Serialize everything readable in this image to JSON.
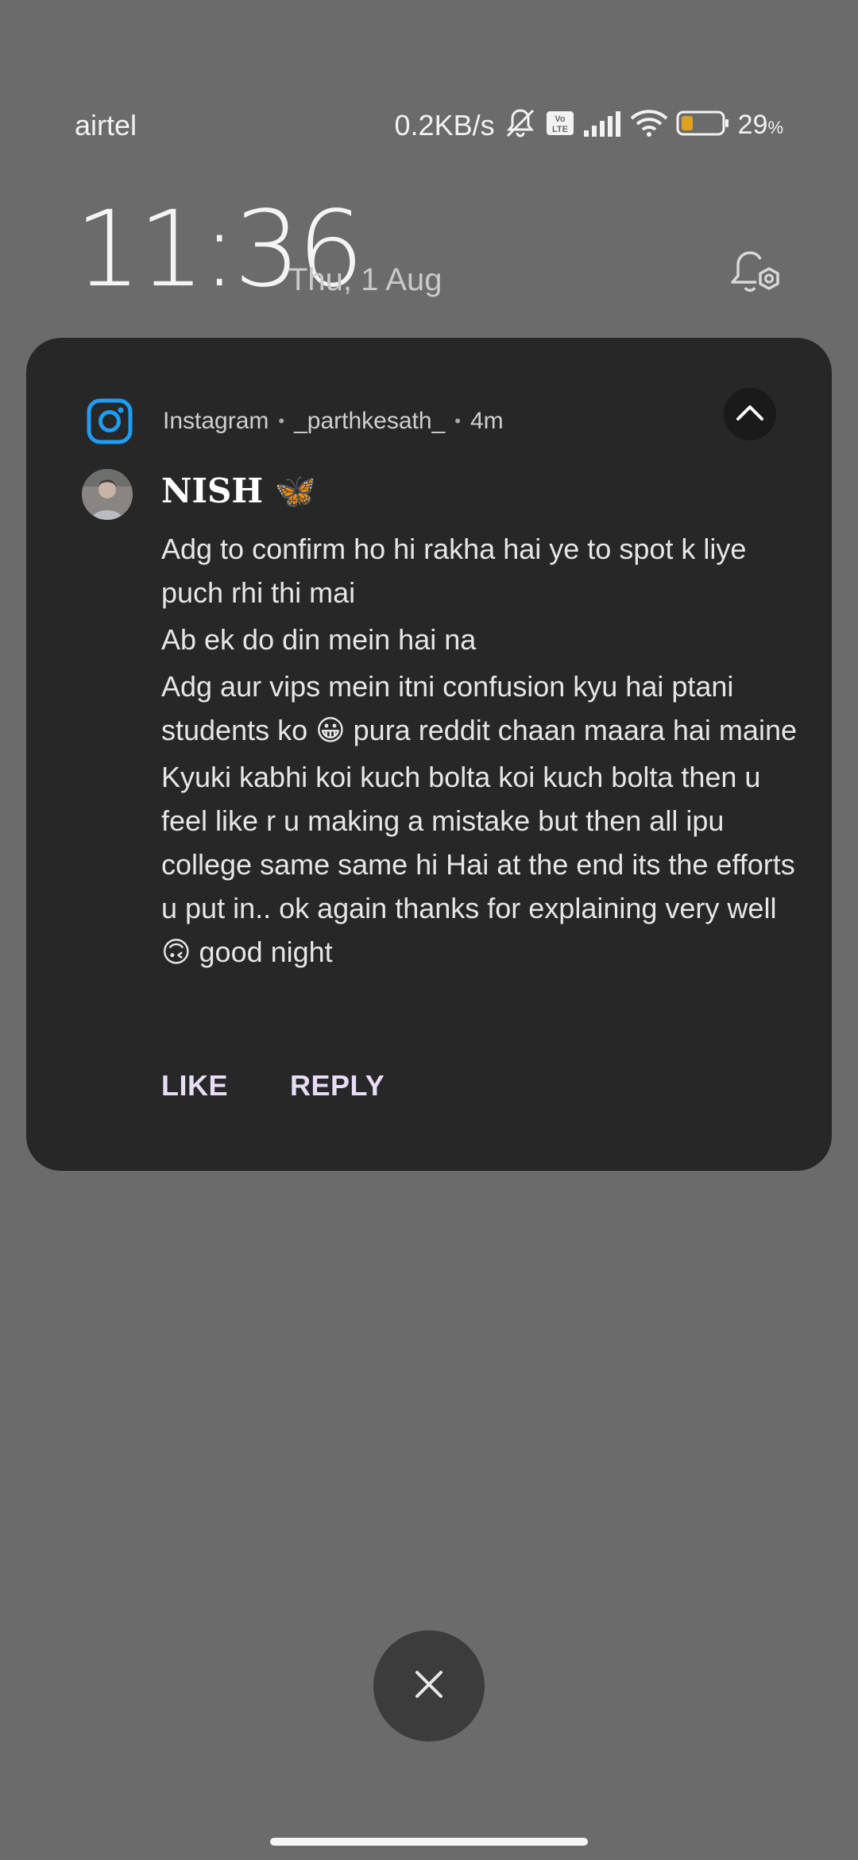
{
  "status_bar": {
    "carrier": "airtel",
    "net_speed": "0.2KB/s",
    "battery_percent": "29",
    "battery_unit": "%",
    "battery_level": 0.29,
    "icons": [
      "mute-bell-icon",
      "volte-icon",
      "signal-icon",
      "wifi-icon",
      "battery-icon"
    ]
  },
  "lockscreen": {
    "time": "11:36",
    "date": "Thu, 1 Aug"
  },
  "notification": {
    "app": "Instagram",
    "account": "_parthkesath_",
    "age": "4m",
    "sender": "NISH 🦋",
    "messages": [
      "Adg to confirm ho hi rakha hai ye to spot k liye puch rhi thi mai",
      "Ab ek do din mein hai na",
      "Adg aur vips mein itni confusion kyu hai ptani students ko 😀 pura reddit chaan maara hai maine",
      "Kyuki kabhi koi kuch bolta koi kuch bolta then u feel like r u making a mistake but then all ipu college same same hi Hai at the end its the efforts u put in.. ok again thanks for explaining very well 🙃 good night"
    ],
    "actions": {
      "like": "LIKE",
      "reply": "REPLY"
    }
  },
  "colors": {
    "background": "#6b6b6b",
    "card": "#272727",
    "instagram_blue": "#1e9df5",
    "action_text": "#e8dcf6",
    "battery_fill": "#e0a020"
  }
}
